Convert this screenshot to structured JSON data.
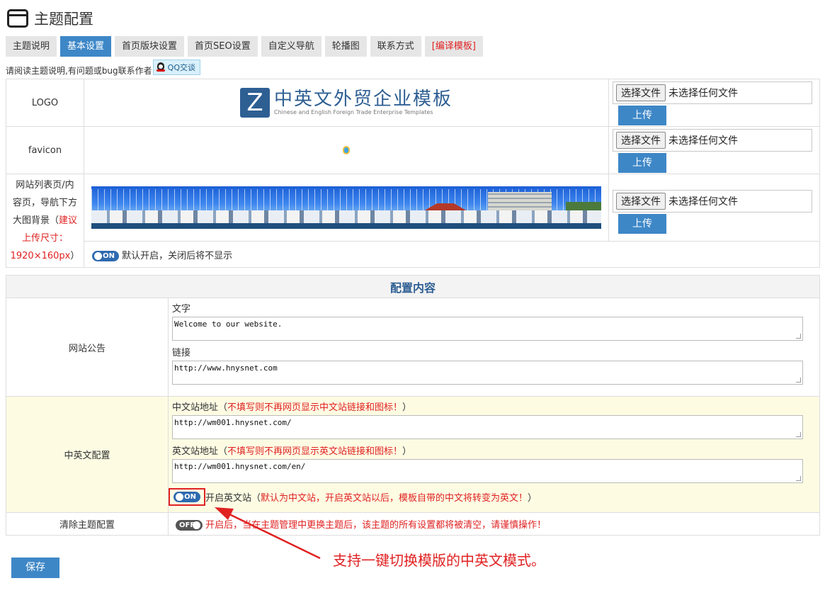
{
  "header": {
    "title": "主题配置",
    "icon": "window-icon"
  },
  "tabs": [
    {
      "label": "主题说明"
    },
    {
      "label": "基本设置",
      "active": true
    },
    {
      "label": "首页版块设置"
    },
    {
      "label": "首页SEO设置"
    },
    {
      "label": "自定义导航"
    },
    {
      "label": "轮播图"
    },
    {
      "label": "联系方式"
    },
    {
      "label": "[编译模板]",
      "color": "#e02222"
    }
  ],
  "notice": {
    "text": "请阅读主题说明,有问题或bug联系作者",
    "qq_label": "QQ交谈"
  },
  "uploads": {
    "choose_file": "选择文件",
    "no_file": "未选择任何文件",
    "upload_label": "上传"
  },
  "logo": {
    "label": "LOGO",
    "letter": "Z",
    "title": "中英文外贸企业模板",
    "subtitle": "Chinese and English Foreign Trade Enterprise Templates"
  },
  "favicon": {
    "label": "favicon"
  },
  "banner": {
    "label_line1": "网站列表页/内",
    "label_line2": "容页，导航下方",
    "label_line3a": "大图背景（",
    "label_line3b": "建议",
    "label_line4": "上传尺寸：",
    "label_line5": "1920×160px",
    "label_line5_end": "）",
    "toggle": "ON",
    "toggle_text": "默认开启，关闭后将不显示"
  },
  "config": {
    "heading": "配置内容",
    "announcement": {
      "label": "网站公告",
      "text_label": "文字",
      "text_value": "Welcome to our website.",
      "link_label": "链接",
      "link_value": "http://www.hnysnet.com"
    },
    "bilingual": {
      "label": "中英文配置",
      "cn_label": "中文站地址（",
      "cn_hint": "不填写则不再网页显示中文站链接和图标！",
      "cn_end": "）",
      "cn_value": "http://wm001.hnysnet.com/",
      "en_label": "英文站地址（",
      "en_hint": "不填写则不再网页显示英文站链接和图标！",
      "en_end": "）",
      "en_value": "http://wm001.hnysnet.com/en/",
      "toggle": "ON",
      "toggle_text": "开启英文站（",
      "toggle_hint": "默认为中文站，开启英文站以后，模板自带的中文将转变为英文！",
      "toggle_end": "）"
    },
    "clear": {
      "label": "清除主题配置",
      "toggle": "OFF",
      "hint": "开启后，当在主题管理中更换主题后，该主题的所有设置都将被清空，请谨慎操作！"
    }
  },
  "save_label": "保存",
  "annotation": "支持一键切换模版的中英文模式。",
  "colors": {
    "accent": "#3e87c7",
    "warning": "#e02222",
    "highlight_bg": "#fdfce3"
  }
}
